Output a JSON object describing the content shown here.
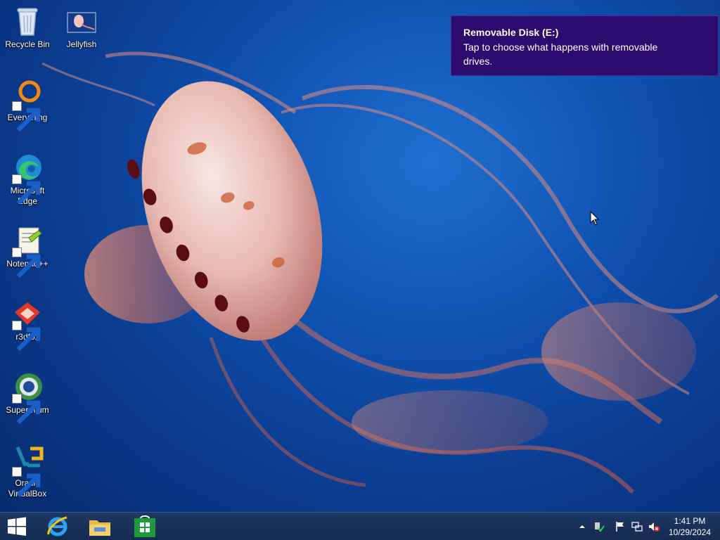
{
  "desktop": {
    "icons": [
      {
        "label": "Recycle Bin",
        "icon": "recycle-bin-icon"
      },
      {
        "label": "Jellyfish",
        "icon": "image-file-icon"
      },
      {
        "label": "Everything",
        "icon": "everything-search-icon"
      },
      {
        "label": "Microsoft Edge",
        "icon": "edge-icon"
      },
      {
        "label": "Notepad++",
        "icon": "notepad-plus-plus-icon"
      },
      {
        "label": "r3dfox",
        "icon": "r3dfox-icon"
      },
      {
        "label": "Supermium",
        "icon": "supermium-icon"
      },
      {
        "label": "Oracle VirtualBox",
        "icon": "virtualbox-icon"
      }
    ]
  },
  "toast": {
    "title": "Removable Disk (E:)",
    "body": "Tap to choose what happens with removable drives."
  },
  "taskbar": {
    "pinned": [
      {
        "name": "Internet Explorer",
        "icon": "internet-explorer-icon"
      },
      {
        "name": "File Explorer",
        "icon": "file-explorer-icon"
      },
      {
        "name": "Store",
        "icon": "store-icon"
      }
    ],
    "tray": {
      "icons": [
        "show-hidden-icons-chevron",
        "safely-remove-hardware-icon",
        "action-center-flag-icon",
        "network-icon",
        "volume-muted-icon"
      ],
      "time": "1:41 PM",
      "date": "10/29/2024"
    }
  },
  "colors": {
    "toast_bg": "#2d0a6e",
    "taskbar_bg": "#1d3763",
    "wallpaper_base": "#0e4fae"
  }
}
